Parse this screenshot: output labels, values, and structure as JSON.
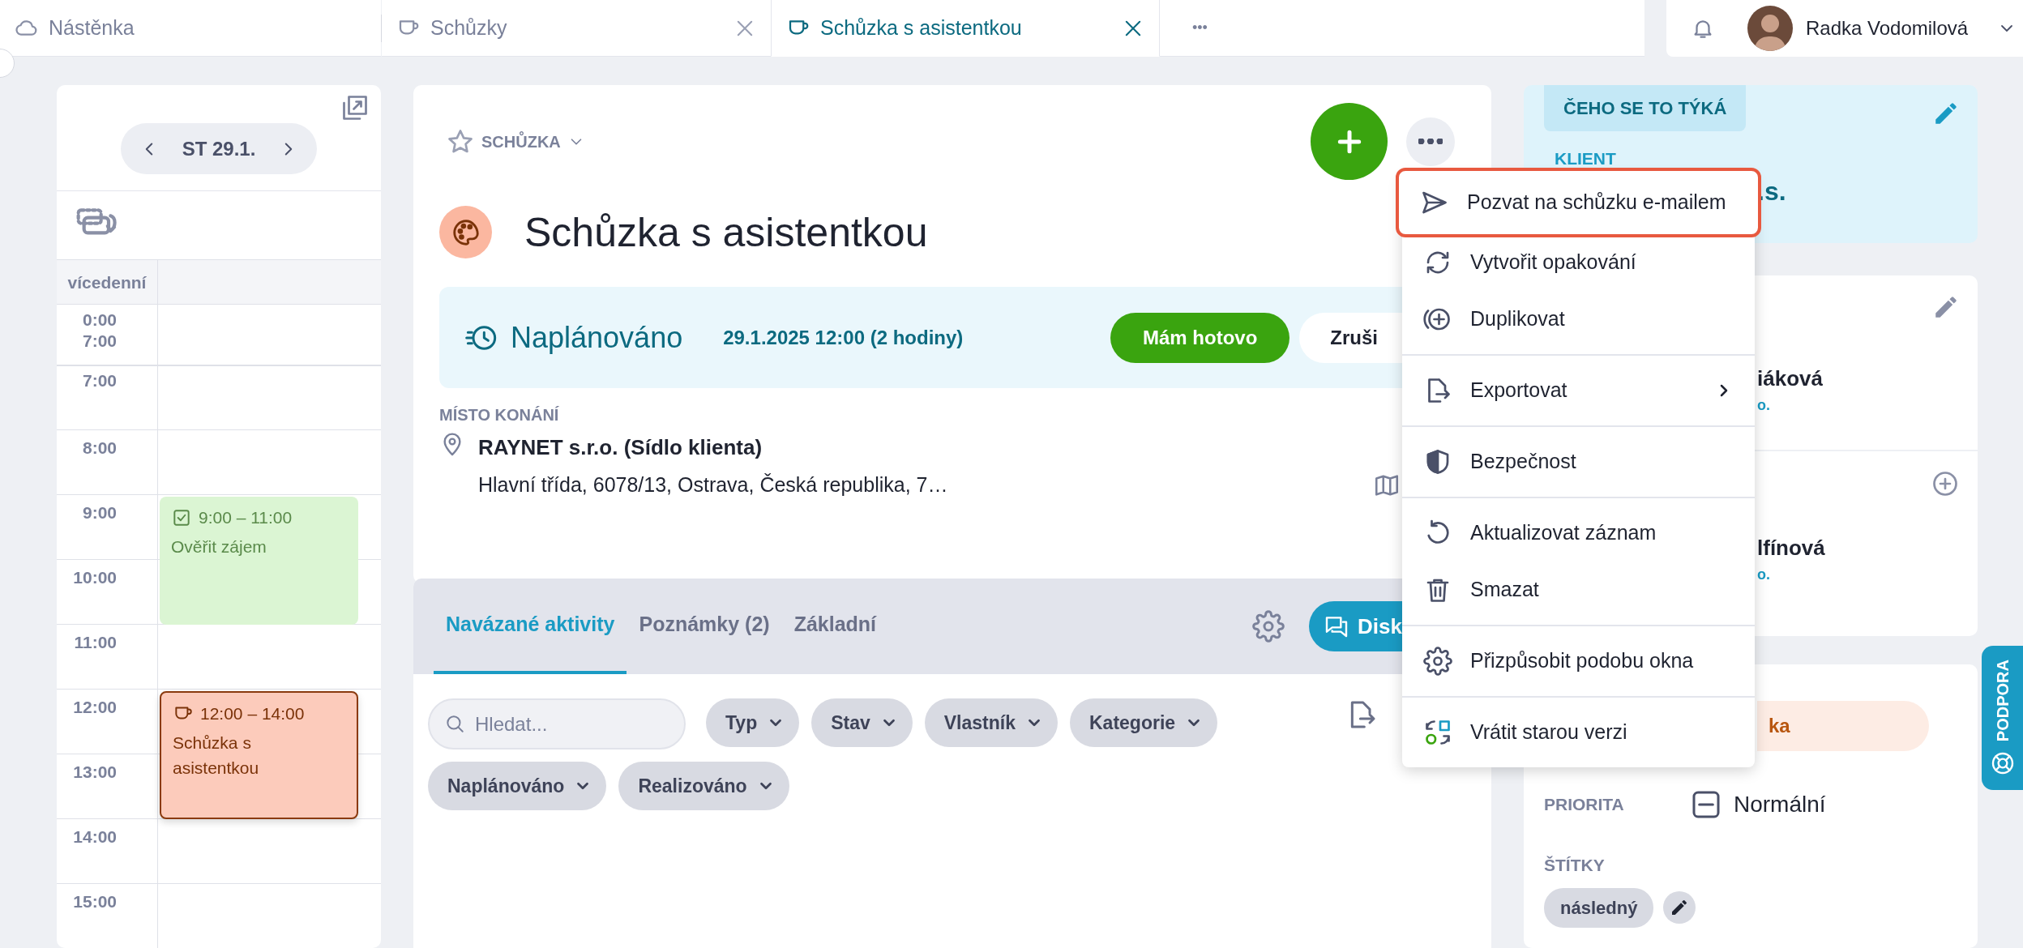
{
  "tabs": [
    {
      "kind": "dashboard",
      "label": "Nástěnka",
      "selected": false,
      "closable": false
    },
    {
      "kind": "meeting",
      "label": "Schůzky",
      "selected": false,
      "closable": true
    },
    {
      "kind": "meeting",
      "label": "Schůzka s asistentkou",
      "selected": true,
      "closable": true
    },
    {
      "kind": "more",
      "label": "•••",
      "selected": false,
      "closable": false
    }
  ],
  "user": {
    "name": "Radka Vodomilová"
  },
  "calendar": {
    "date": "ST 29.1.",
    "allday_label": "vícedenní",
    "collapsed": {
      "from": "0:00",
      "to": "7:00"
    },
    "hours": [
      {
        "label": "7:00"
      },
      {
        "label": "8:00"
      },
      {
        "label": "9:00",
        "events": [
          {
            "kind": "task",
            "time": "9:00 – 11:00",
            "title": "Ověřit zájem"
          }
        ]
      },
      {
        "label": "10:00"
      },
      {
        "label": "11:00"
      },
      {
        "label": "12:00",
        "events": [
          {
            "kind": "meeting",
            "time": "12:00 – 14:00",
            "title": "Schůzka s asistentkou"
          }
        ]
      },
      {
        "label": "13:00"
      },
      {
        "label": "14:00"
      },
      {
        "label": "15:00"
      }
    ]
  },
  "record": {
    "type_label": "SCHŮZKA",
    "favorite": false,
    "title": "Schůzka s asistentkou",
    "status": "Naplánováno",
    "datetime": "29.1.2025 12:00 (2 hodiny)",
    "actions": [
      {
        "kind": "primary",
        "label": "Mám hotovo"
      },
      {
        "kind": "secondary",
        "label": "Zruši"
      }
    ],
    "place_label": "MÍSTO KONÁNÍ",
    "place_name": "RAYNET s.r.o. (Sídlo klienta)",
    "place_address": "Hlavní třída, 6078/13, Ostrava, Česká republika, 7…"
  },
  "menu": {
    "groups": [
      [
        {
          "kind": "invite",
          "label": "Pozvat na schůzku e-mailem",
          "highlighted": true,
          "submenu": false
        },
        {
          "kind": "repeat",
          "label": "Vytvořit opakování",
          "highlighted": false,
          "submenu": false
        },
        {
          "kind": "duplicate",
          "label": "Duplikovat",
          "highlighted": false,
          "submenu": false
        }
      ],
      [
        {
          "kind": "export",
          "label": "Exportovat",
          "highlighted": false,
          "submenu": true
        }
      ],
      [
        {
          "kind": "security",
          "label": "Bezpečnost",
          "highlighted": false,
          "submenu": false
        }
      ],
      [
        {
          "kind": "refresh",
          "label": "Aktualizovat záznam",
          "highlighted": false,
          "submenu": false
        },
        {
          "kind": "delete",
          "label": "Smazat",
          "highlighted": false,
          "submenu": false
        }
      ],
      [
        {
          "kind": "customize",
          "label": "Přizpůsobit podobu okna",
          "highlighted": false,
          "submenu": false
        }
      ],
      [
        {
          "kind": "revert",
          "label": "Vrátit starou verzi",
          "highlighted": false,
          "submenu": false
        }
      ]
    ]
  },
  "related": {
    "tabs": [
      {
        "label": "Navázané aktivity",
        "selected": true
      },
      {
        "label": "Poznámky (2)",
        "selected": false
      },
      {
        "label": "Základní",
        "selected": false
      }
    ],
    "discuss_button": "Disk",
    "search": {
      "placeholder": "Hledat..."
    },
    "filters": [
      "Typ",
      "Stav",
      "Vlastník",
      "Kategorie",
      "Naplánováno",
      "Realizováno"
    ]
  },
  "side": {
    "about": {
      "tag": "ČEHO SE TO TÝKÁ",
      "client_label": "KLIENT",
      "client_name": ".s."
    },
    "contacts": [
      {
        "kind": "edit",
        "name": "iáková",
        "company": "o."
      },
      {
        "kind": "add",
        "name": "lfínová",
        "company": "o."
      }
    ],
    "details": {
      "status": "ka",
      "priority_label": "PRIORITA",
      "priority": "Normální",
      "tags_label": "ŠTÍTKY",
      "tags": [
        "následný"
      ]
    }
  },
  "support": "PODPORA"
}
